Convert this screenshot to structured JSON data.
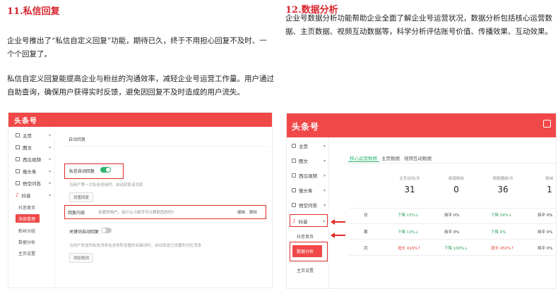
{
  "section_left": {
    "title": "11.私信回复",
    "para1_line1": "企业号推出了“私信自定义回复”功能，期待已久，终于不用担心回复不及时、一",
    "para1_line2": "个个回复了。",
    "para2_line1": "私信自定义回复能提高企业与粉丝的沟通效率，减轻企业号运营工作量。用户通过",
    "para2_line2": "自助查询，确保用户获得实时反馈，避免因回复不及时造成的用户流失。"
  },
  "section_right": {
    "title": "12.数据分析",
    "para_line1": "企业号数据分析功能帮助企业全面了解企业号运营状况，数据分析包括核心运营数",
    "para_line2": "据、主页数据、视频互动数据等，科学分析评估账号价值、传播效果、互动效果。"
  },
  "left_shot": {
    "brand": "头条号",
    "nav": [
      "主页",
      "图文",
      "西瓜视频",
      "微头条",
      "悟空问答",
      "抖音"
    ],
    "sub": [
      "抖音首页",
      "消息管理",
      "粉丝分组",
      "数据分析",
      "主页设置"
    ],
    "panel_title": "自动回复",
    "toggle1_label": "私信自动回复",
    "hint1": "当用户第一次私信咨询时，自动回复该消息",
    "btn_edit": "设置回复",
    "reply_label": "回复内容",
    "reply_text": "亲爱的用户，有什么小助手可以帮助您的吗?",
    "reply_edit": "编辑",
    "reply_delete": "删除",
    "toggle2_label": "关键词自动回复",
    "hint2": "当用户发送的私信消息包含你所设置的关键词时，自动发送已设置的对应消息",
    "btn_add": "添加规则"
  },
  "right_shot": {
    "brand": "头条号",
    "nav": [
      "主页",
      "图文",
      "西瓜视频",
      "微头条",
      "悟空问答",
      "抖音"
    ],
    "sub": [
      "抖音首页",
      "数据分析",
      "主页设置"
    ],
    "tabs": [
      "核心运营数据",
      "主页数据",
      "视频互动数据"
    ],
    "stats": [
      {
        "label": "主页访问/次",
        "value": "31"
      },
      {
        "label": "新增粉丝",
        "value": "0"
      },
      {
        "label": "视频播放/次",
        "value": "36"
      },
      {
        "label": "粉丝",
        "value": "1"
      }
    ],
    "rows": [
      {
        "period": "日",
        "c1": "下降 15%↓",
        "c2": "持平 0%",
        "c3": "下降 54%↓",
        "c4": "持平 0%"
      },
      {
        "period": "周",
        "c1": "下降 13%↓",
        "c2": "持平 0%",
        "c3": "下降 0%",
        "c4": "持平 0%"
      },
      {
        "period": "月",
        "c1": "增长 416%↑",
        "c2": "下降 100%↓",
        "c3": "增长 450%↑",
        "c4": "持平 0%"
      }
    ]
  },
  "colors": {
    "accent_red": "#d8262e",
    "brand_red": "#f04848",
    "toggle_green": "#2db36b",
    "up_red": "#e24a3b",
    "down_green": "#27a15a"
  }
}
